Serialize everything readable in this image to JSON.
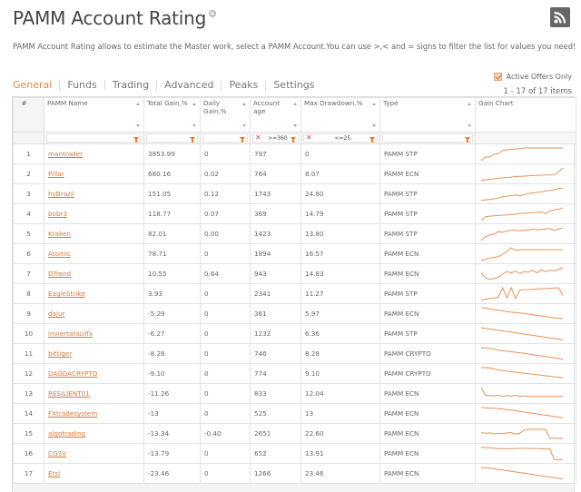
{
  "header": {
    "title": "PAMM Account Rating",
    "help_icon": "help-icon",
    "rss_icon": "rss-icon",
    "description": "PAMM Account Rating allows to estimate the Master work, select a PAMM Account.You can use >,< and = signs to filter the list for values you need!"
  },
  "tabs": [
    {
      "label": "General",
      "active": true
    },
    {
      "label": "Funds",
      "active": false
    },
    {
      "label": "Trading",
      "active": false
    },
    {
      "label": "Advanced",
      "active": false
    },
    {
      "label": "Peaks",
      "active": false
    },
    {
      "label": "Settings",
      "active": false
    }
  ],
  "options": {
    "active_offers_label": "Active Offers Only",
    "active_offers_checked": true,
    "items_count": "1 - 17 of 17 items"
  },
  "colors": {
    "accent": "#e08a4a",
    "link": "#d9793a",
    "chart_line": "#e8925a",
    "filter_icon": "#f07a2a",
    "clear_icon": "#e03c3c"
  },
  "table": {
    "columns": [
      {
        "key": "num",
        "label": "#"
      },
      {
        "key": "name",
        "label": "PAMM Name"
      },
      {
        "key": "total_gain",
        "label": "Total Gain,%"
      },
      {
        "key": "daily_gain",
        "label": "Daily Gain,%"
      },
      {
        "key": "age",
        "label": "Account age"
      },
      {
        "key": "max_dd",
        "label": "Max Drawdown,%"
      },
      {
        "key": "type",
        "label": "Type"
      },
      {
        "key": "chart",
        "label": "Gain Chart"
      }
    ],
    "filters": {
      "name": "",
      "total_gain": "",
      "daily_gain": "",
      "age": ">=360",
      "max_dd": "<=25",
      "type": ""
    },
    "rows": [
      {
        "num": "1",
        "name": "mantrader",
        "total_gain": "3853.99",
        "daily_gain": "0",
        "age": "797",
        "max_dd": "0",
        "type": "PAMM STP",
        "trend": [
          0,
          28,
          30,
          50,
          55,
          80,
          85,
          90,
          92,
          95,
          100,
          100,
          100,
          100,
          100,
          100,
          100,
          100,
          100,
          100
        ]
      },
      {
        "num": "2",
        "name": "Pillar",
        "total_gain": "680.16",
        "daily_gain": "0.02",
        "age": "764",
        "max_dd": "8.07",
        "type": "PAMM ECN",
        "trend": [
          0,
          5,
          10,
          14,
          18,
          22,
          25,
          28,
          32,
          34,
          36,
          38,
          40,
          42,
          43,
          44,
          45,
          46,
          70,
          100
        ]
      },
      {
        "num": "3",
        "name": "hyBrazil",
        "total_gain": "151.05",
        "daily_gain": "0.12",
        "age": "1743",
        "max_dd": "24.80",
        "type": "PAMM STP",
        "trend": [
          0,
          5,
          10,
          15,
          20,
          30,
          35,
          40,
          45,
          38,
          48,
          55,
          60,
          65,
          70,
          75,
          80,
          85,
          95,
          100
        ]
      },
      {
        "num": "4",
        "name": "bobr3",
        "total_gain": "118.77",
        "daily_gain": "0.07",
        "age": "369",
        "max_dd": "14.79",
        "type": "PAMM STP",
        "trend": [
          0,
          30,
          35,
          38,
          40,
          42,
          45,
          48,
          50,
          55,
          58,
          60,
          62,
          65,
          68,
          55,
          75,
          85,
          90,
          100
        ]
      },
      {
        "num": "5",
        "name": "Kraken",
        "total_gain": "82.01",
        "daily_gain": "0.00",
        "age": "1423",
        "max_dd": "13.80",
        "type": "PAMM STP",
        "trend": [
          0,
          30,
          45,
          50,
          70,
          65,
          75,
          80,
          85,
          75,
          85,
          80,
          90,
          85,
          88,
          92,
          95,
          80,
          90,
          100
        ]
      },
      {
        "num": "6",
        "name": "Atomic",
        "total_gain": "78.71",
        "daily_gain": "0",
        "age": "1894",
        "max_dd": "16.57",
        "type": "PAMM ECN",
        "trend": [
          0,
          10,
          20,
          25,
          30,
          50,
          70,
          100,
          80,
          85,
          85,
          85,
          85,
          85,
          85,
          85,
          85,
          85,
          85,
          85
        ]
      },
      {
        "num": "7",
        "name": "DTrend",
        "total_gain": "10.55",
        "daily_gain": "0.64",
        "age": "943",
        "max_dd": "14.83",
        "type": "PAMM ECN",
        "trend": [
          60,
          20,
          10,
          15,
          25,
          50,
          70,
          60,
          75,
          55,
          70,
          65,
          80,
          60,
          85,
          70,
          80,
          75,
          90,
          100
        ]
      },
      {
        "num": "8",
        "name": "EagleStrike",
        "total_gain": "3.93",
        "daily_gain": "0",
        "age": "2341",
        "max_dd": "11.27",
        "type": "PAMM STP",
        "trend": [
          0,
          10,
          15,
          20,
          25,
          100,
          20,
          100,
          15,
          80,
          85,
          85,
          88,
          90,
          92,
          94,
          96,
          98,
          100,
          40
        ]
      },
      {
        "num": "9",
        "name": "dajur",
        "total_gain": "-5.29",
        "daily_gain": "0",
        "age": "361",
        "max_dd": "5.97",
        "type": "PAMM ECN",
        "trend": [
          100,
          98,
          90,
          85,
          80,
          75,
          70,
          65,
          62,
          58,
          55,
          50,
          45,
          40,
          35,
          30,
          25,
          20,
          18,
          15
        ]
      },
      {
        "num": "10",
        "name": "inviertafacilfx",
        "total_gain": "-6.27",
        "daily_gain": "0",
        "age": "1232",
        "max_dd": "6.36",
        "type": "PAMM STP",
        "trend": [
          100,
          95,
          90,
          85,
          80,
          75,
          70,
          65,
          60,
          55,
          50,
          45,
          40,
          35,
          30,
          25,
          20,
          15,
          10,
          5
        ]
      },
      {
        "num": "11",
        "name": "bittiger",
        "total_gain": "-8.28",
        "daily_gain": "0",
        "age": "746",
        "max_dd": "8.28",
        "type": "PAMM CRYPTO",
        "trend": [
          100,
          98,
          95,
          90,
          80,
          75,
          72,
          68,
          64,
          60,
          55,
          50,
          45,
          40,
          35,
          30,
          25,
          20,
          15,
          10
        ]
      },
      {
        "num": "12",
        "name": "DAGDACRYPTO",
        "total_gain": "-9.10",
        "daily_gain": "0",
        "age": "774",
        "max_dd": "9.10",
        "type": "PAMM CRYPTO",
        "trend": [
          100,
          100,
          98,
          90,
          82,
          76,
          72,
          68,
          64,
          60,
          56,
          52,
          48,
          44,
          40,
          36,
          32,
          28,
          24,
          20
        ]
      },
      {
        "num": "13",
        "name": "RESILIENT01",
        "total_gain": "-11.26",
        "daily_gain": "0",
        "age": "833",
        "max_dd": "12.04",
        "type": "PAMM ECN",
        "trend": [
          100,
          40,
          38,
          35,
          40,
          30,
          38,
          32,
          40,
          30,
          35,
          30,
          30,
          30,
          30,
          30,
          30,
          30,
          30,
          30
        ]
      },
      {
        "num": "14",
        "name": "FXtradesystem",
        "total_gain": "-13",
        "daily_gain": "0",
        "age": "525",
        "max_dd": "13",
        "type": "PAMM ECN",
        "trend": [
          100,
          98,
          96,
          95,
          93,
          88,
          84,
          80,
          75,
          70,
          65,
          60,
          55,
          50,
          45,
          40,
          35,
          30,
          25,
          20
        ]
      },
      {
        "num": "15",
        "name": "algotrading",
        "total_gain": "-13.34",
        "daily_gain": "-0.40",
        "age": "2651",
        "max_dd": "22.60",
        "type": "PAMM ECN",
        "trend": [
          60,
          55,
          58,
          50,
          55,
          52,
          58,
          60,
          48,
          55,
          80,
          85,
          88,
          85,
          88,
          85,
          15,
          18,
          15,
          15
        ]
      },
      {
        "num": "16",
        "name": "CGSV",
        "total_gain": "-13.79",
        "daily_gain": "0",
        "age": "652",
        "max_dd": "13.91",
        "type": "PAMM ECN",
        "trend": [
          100,
          100,
          98,
          95,
          90,
          92,
          90,
          90,
          92,
          93,
          94,
          93,
          92,
          92,
          90,
          90,
          90,
          5,
          5,
          5
        ]
      },
      {
        "num": "17",
        "name": "Etsi",
        "total_gain": "-23.46",
        "daily_gain": "0",
        "age": "1266",
        "max_dd": "23.46",
        "type": "PAMM ECN",
        "trend": [
          100,
          98,
          95,
          90,
          85,
          80,
          75,
          70,
          65,
          60,
          55,
          50,
          45,
          40,
          35,
          30,
          25,
          20,
          15,
          10
        ]
      }
    ]
  }
}
